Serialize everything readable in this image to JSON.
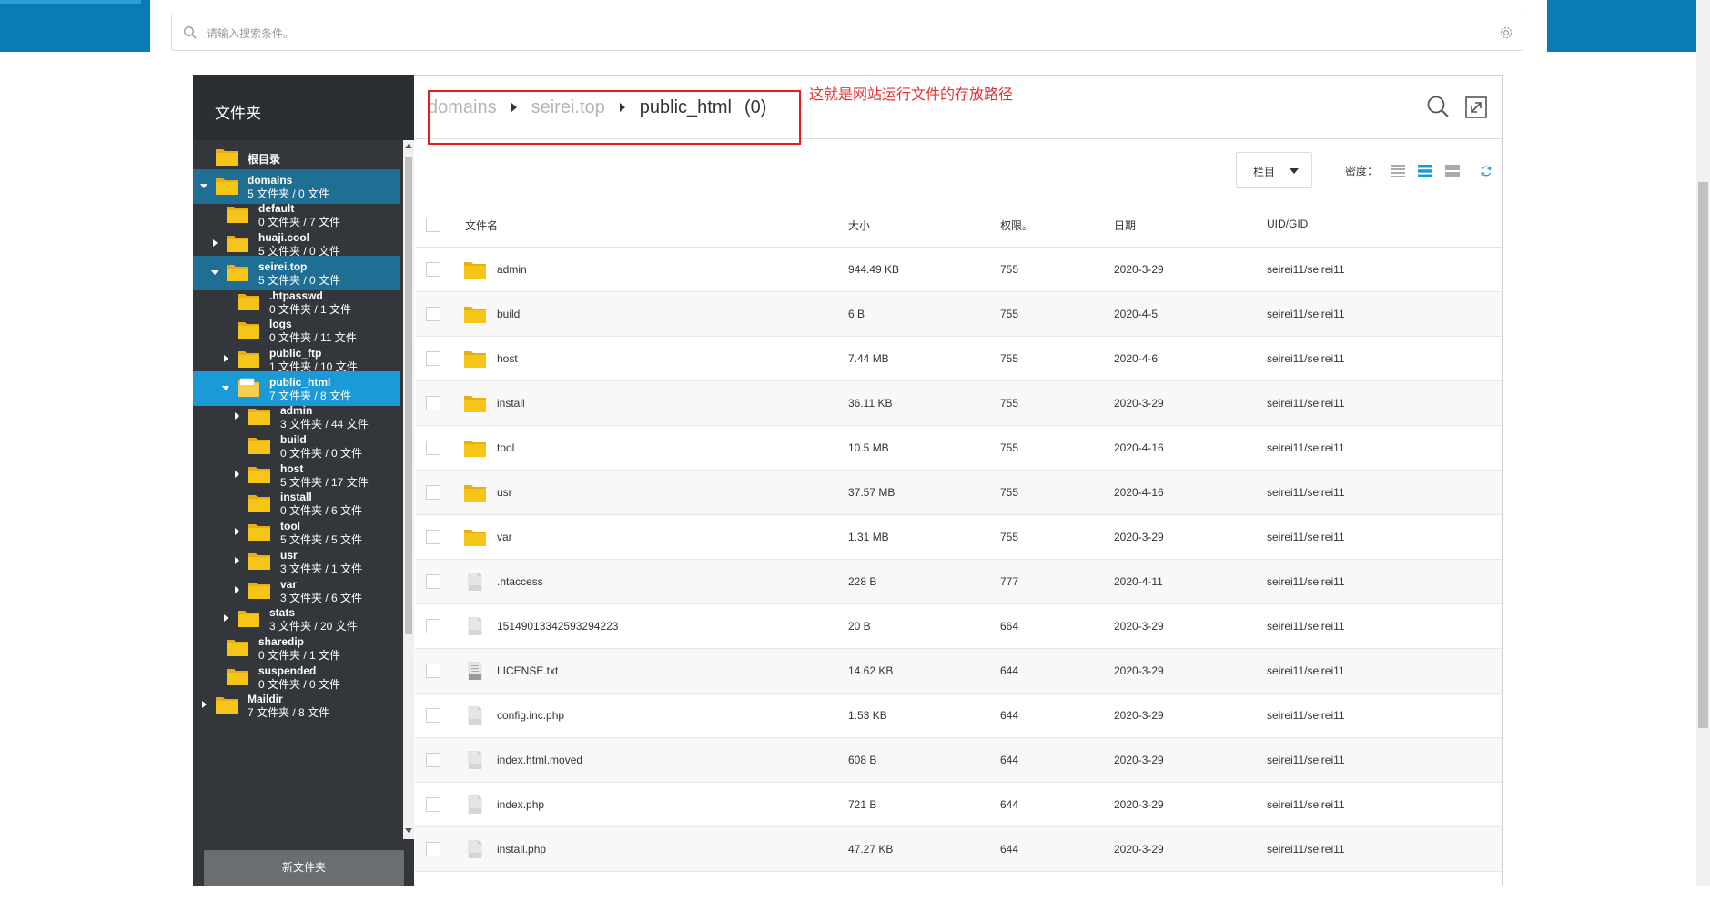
{
  "search": {
    "placeholder": "请输入搜索条件。"
  },
  "sidebar": {
    "title": "文件夹",
    "new_folder_label": "新文件夹",
    "tree": [
      {
        "name": "根目录",
        "meta": "",
        "level": 0,
        "arrow": "",
        "state": "",
        "icon": "root-folder-icon"
      },
      {
        "name": "domains",
        "meta": "5 文件夹 / 0 文件",
        "level": 0,
        "arrow": "down",
        "state": "selected-parent",
        "icon": "folder-icon"
      },
      {
        "name": "default",
        "meta": "0 文件夹 / 7 文件",
        "level": 1,
        "arrow": "",
        "state": "",
        "icon": "folder-icon"
      },
      {
        "name": "huaji.cool",
        "meta": "5 文件夹 / 0 文件",
        "level": 1,
        "arrow": "right",
        "state": "",
        "icon": "folder-icon"
      },
      {
        "name": "seirei.top",
        "meta": "5 文件夹 / 0 文件",
        "level": 1,
        "arrow": "down",
        "state": "selected-parent",
        "icon": "folder-icon"
      },
      {
        "name": ".htpasswd",
        "meta": "0 文件夹 / 1 文件",
        "level": 2,
        "arrow": "",
        "state": "",
        "icon": "folder-icon"
      },
      {
        "name": "logs",
        "meta": "0 文件夹 / 11 文件",
        "level": 2,
        "arrow": "",
        "state": "",
        "icon": "folder-icon"
      },
      {
        "name": "public_ftp",
        "meta": "1 文件夹 / 10 文件",
        "level": 2,
        "arrow": "right",
        "state": "",
        "icon": "folder-icon"
      },
      {
        "name": "public_html",
        "meta": "7 文件夹 / 8 文件",
        "level": 2,
        "arrow": "down",
        "state": "selected",
        "icon": "open-folder-icon"
      },
      {
        "name": "admin",
        "meta": "3 文件夹 / 44 文件",
        "level": 3,
        "arrow": "right",
        "state": "",
        "icon": "folder-icon"
      },
      {
        "name": "build",
        "meta": "0 文件夹 / 0 文件",
        "level": 3,
        "arrow": "",
        "state": "",
        "icon": "folder-icon"
      },
      {
        "name": "host",
        "meta": "5 文件夹 / 17 文件",
        "level": 3,
        "arrow": "right",
        "state": "",
        "icon": "folder-icon"
      },
      {
        "name": "install",
        "meta": "0 文件夹 / 6 文件",
        "level": 3,
        "arrow": "",
        "state": "",
        "icon": "folder-icon"
      },
      {
        "name": "tool",
        "meta": "5 文件夹 / 5 文件",
        "level": 3,
        "arrow": "right",
        "state": "",
        "icon": "folder-icon"
      },
      {
        "name": "usr",
        "meta": "3 文件夹 / 1 文件",
        "level": 3,
        "arrow": "right",
        "state": "",
        "icon": "folder-icon"
      },
      {
        "name": "var",
        "meta": "3 文件夹 / 6 文件",
        "level": 3,
        "arrow": "right",
        "state": "",
        "icon": "folder-icon"
      },
      {
        "name": "stats",
        "meta": "3 文件夹 / 20 文件",
        "level": 2,
        "arrow": "right",
        "state": "",
        "icon": "folder-icon"
      },
      {
        "name": "sharedip",
        "meta": "0 文件夹 / 1 文件",
        "level": 1,
        "arrow": "",
        "state": "",
        "icon": "folder-icon"
      },
      {
        "name": "suspended",
        "meta": "0 文件夹 / 0 文件",
        "level": 1,
        "arrow": "",
        "state": "",
        "icon": "folder-icon"
      },
      {
        "name": "Maildir",
        "meta": "7 文件夹 / 8 文件",
        "level": 0,
        "arrow": "right",
        "state": "",
        "icon": "folder-icon"
      }
    ]
  },
  "breadcrumb": {
    "items": [
      "domains",
      "seirei.top",
      "public_html"
    ],
    "count": "(0)"
  },
  "annotation": "这就是网站运行文件的存放路径",
  "toolbar": {
    "columns_label": "栏目",
    "density_label": "密度："
  },
  "table": {
    "headers": {
      "name": "文件名",
      "size": "大小",
      "perm": "权限。",
      "date": "日期",
      "uid": "UID/GID"
    },
    "rows": [
      {
        "type": "folder",
        "name": "admin",
        "size": "944.49 KB",
        "perm": "755",
        "date": "2020-3-29",
        "uid": "seirei11/seirei11"
      },
      {
        "type": "folder",
        "name": "build",
        "size": "6 B",
        "perm": "755",
        "date": "2020-4-5",
        "uid": "seirei11/seirei11"
      },
      {
        "type": "folder",
        "name": "host",
        "size": "7.44 MB",
        "perm": "755",
        "date": "2020-4-6",
        "uid": "seirei11/seirei11"
      },
      {
        "type": "folder",
        "name": "install",
        "size": "36.11 KB",
        "perm": "755",
        "date": "2020-3-29",
        "uid": "seirei11/seirei11"
      },
      {
        "type": "folder",
        "name": "tool",
        "size": "10.5 MB",
        "perm": "755",
        "date": "2020-4-16",
        "uid": "seirei11/seirei11"
      },
      {
        "type": "folder",
        "name": "usr",
        "size": "37.57 MB",
        "perm": "755",
        "date": "2020-4-16",
        "uid": "seirei11/seirei11"
      },
      {
        "type": "folder",
        "name": "var",
        "size": "1.31 MB",
        "perm": "755",
        "date": "2020-3-29",
        "uid": "seirei11/seirei11"
      },
      {
        "type": "file",
        "name": ".htaccess",
        "size": "228 B",
        "perm": "777",
        "date": "2020-4-11",
        "uid": "seirei11/seirei11"
      },
      {
        "type": "file",
        "name": "15149013342593294223",
        "size": "20 B",
        "perm": "664",
        "date": "2020-3-29",
        "uid": "seirei11/seirei11"
      },
      {
        "type": "txt",
        "name": "LICENSE.txt",
        "size": "14.62 KB",
        "perm": "644",
        "date": "2020-3-29",
        "uid": "seirei11/seirei11"
      },
      {
        "type": "file",
        "name": "config.inc.php",
        "size": "1.53 KB",
        "perm": "644",
        "date": "2020-3-29",
        "uid": "seirei11/seirei11"
      },
      {
        "type": "file",
        "name": "index.html.moved",
        "size": "608 B",
        "perm": "644",
        "date": "2020-3-29",
        "uid": "seirei11/seirei11"
      },
      {
        "type": "file",
        "name": "index.php",
        "size": "721 B",
        "perm": "644",
        "date": "2020-3-29",
        "uid": "seirei11/seirei11"
      },
      {
        "type": "file",
        "name": "install.php",
        "size": "47.27 KB",
        "perm": "644",
        "date": "2020-3-29",
        "uid": "seirei11/seirei11"
      }
    ]
  },
  "colors": {
    "brand": "#0b7bb6",
    "sidebar_bg": "#33373b",
    "selected": "#1a9bd7",
    "selected_parent": "#1f6f94",
    "folder": "#f5c518",
    "annotation": "#e83030",
    "density_active": "#1a9bd7"
  }
}
